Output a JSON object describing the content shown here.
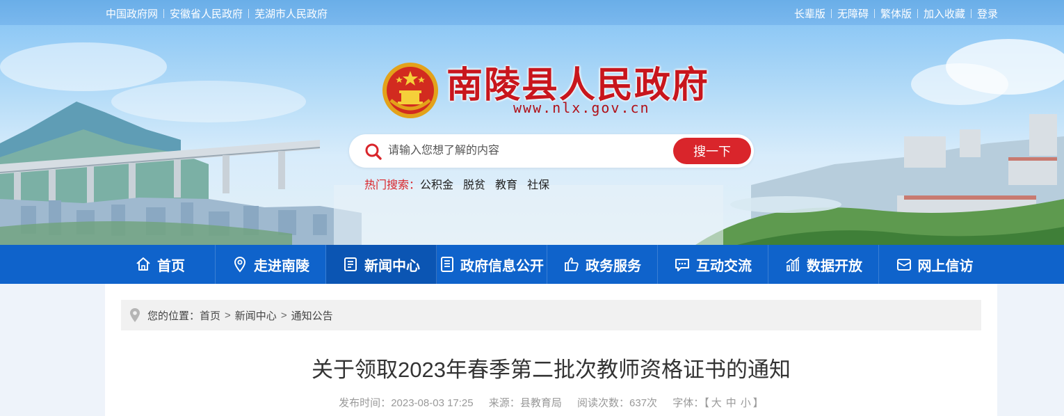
{
  "topbar": {
    "left_links": [
      "中国政府网",
      "安徽省人民政府",
      "芜湖市人民政府"
    ],
    "right_links": [
      "长辈版",
      "无障碍",
      "繁体版",
      "加入收藏",
      "登录"
    ]
  },
  "header": {
    "site_title": "南陵县人民政府",
    "site_url": "www.nlx.gov.cn"
  },
  "search": {
    "placeholder": "请输入您想了解的内容",
    "button_label": "搜一下",
    "hot_label": "热门搜索：",
    "hot_items": [
      "公积金",
      "脱贫",
      "教育",
      "社保"
    ]
  },
  "nav": {
    "items": [
      {
        "label": "首页",
        "icon": "home-icon"
      },
      {
        "label": "走进南陵",
        "icon": "location-icon"
      },
      {
        "label": "新闻中心",
        "icon": "news-icon"
      },
      {
        "label": "政府信息公开",
        "icon": "document-icon"
      },
      {
        "label": "政务服务",
        "icon": "thumbs-up-icon"
      },
      {
        "label": "互动交流",
        "icon": "chat-icon"
      },
      {
        "label": "数据开放",
        "icon": "chart-icon"
      },
      {
        "label": "网上信访",
        "icon": "mail-icon"
      }
    ],
    "active_index": 2
  },
  "breadcrumb": {
    "prefix": "您的位置：",
    "items": [
      "首页",
      "新闻中心",
      "通知公告"
    ]
  },
  "article": {
    "title": "关于领取2023年春季第二批次教师资格证书的通知",
    "publish_label": "发布时间：",
    "publish_time": "2023-08-03 17:25",
    "source_label": "来源：",
    "source": "县教育局",
    "views_label": "阅读次数：",
    "views": "637次",
    "font_label": "字体：",
    "font_open": "【",
    "font_large": "大",
    "font_medium": "中",
    "font_small": "小",
    "font_close": "】"
  },
  "colors": {
    "nav_blue": "#0f63cb",
    "brand_red": "#d9252b",
    "topbar_blue": "#6aaee8"
  }
}
